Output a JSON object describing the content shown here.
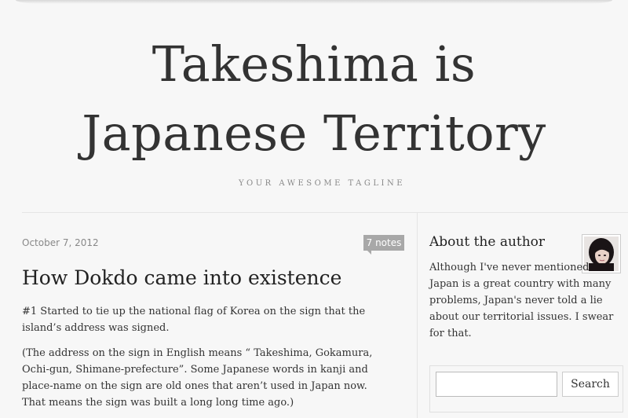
{
  "site": {
    "title": "Takeshima is Japanese Territory",
    "tagline": "YOUR AWESOME TAGLINE"
  },
  "post": {
    "date": "October 7, 2012",
    "notes": "7 notes",
    "title": "How Dokdo came into existence",
    "paragraphs": [
      "#1 Started to tie up the national flag of Korea on the sign that the island’s address was signed.",
      "(The address on the sign in English means “ Takeshima, Gokamura, Ochi-gun, Shimane-prefecture”. Some Japanese words in kanji and place-name on the sign are old ones that aren’t used in Japan now. That means the sign was built a long long time ago.)"
    ]
  },
  "sidebar": {
    "heading": "About the author",
    "about": "Although I've never mentioned Japan is a great country with many problems, Japan's never told a lie about our territorial issues. I swear for that.",
    "search": {
      "value": "",
      "placeholder": "",
      "button_label": "Search"
    }
  }
}
